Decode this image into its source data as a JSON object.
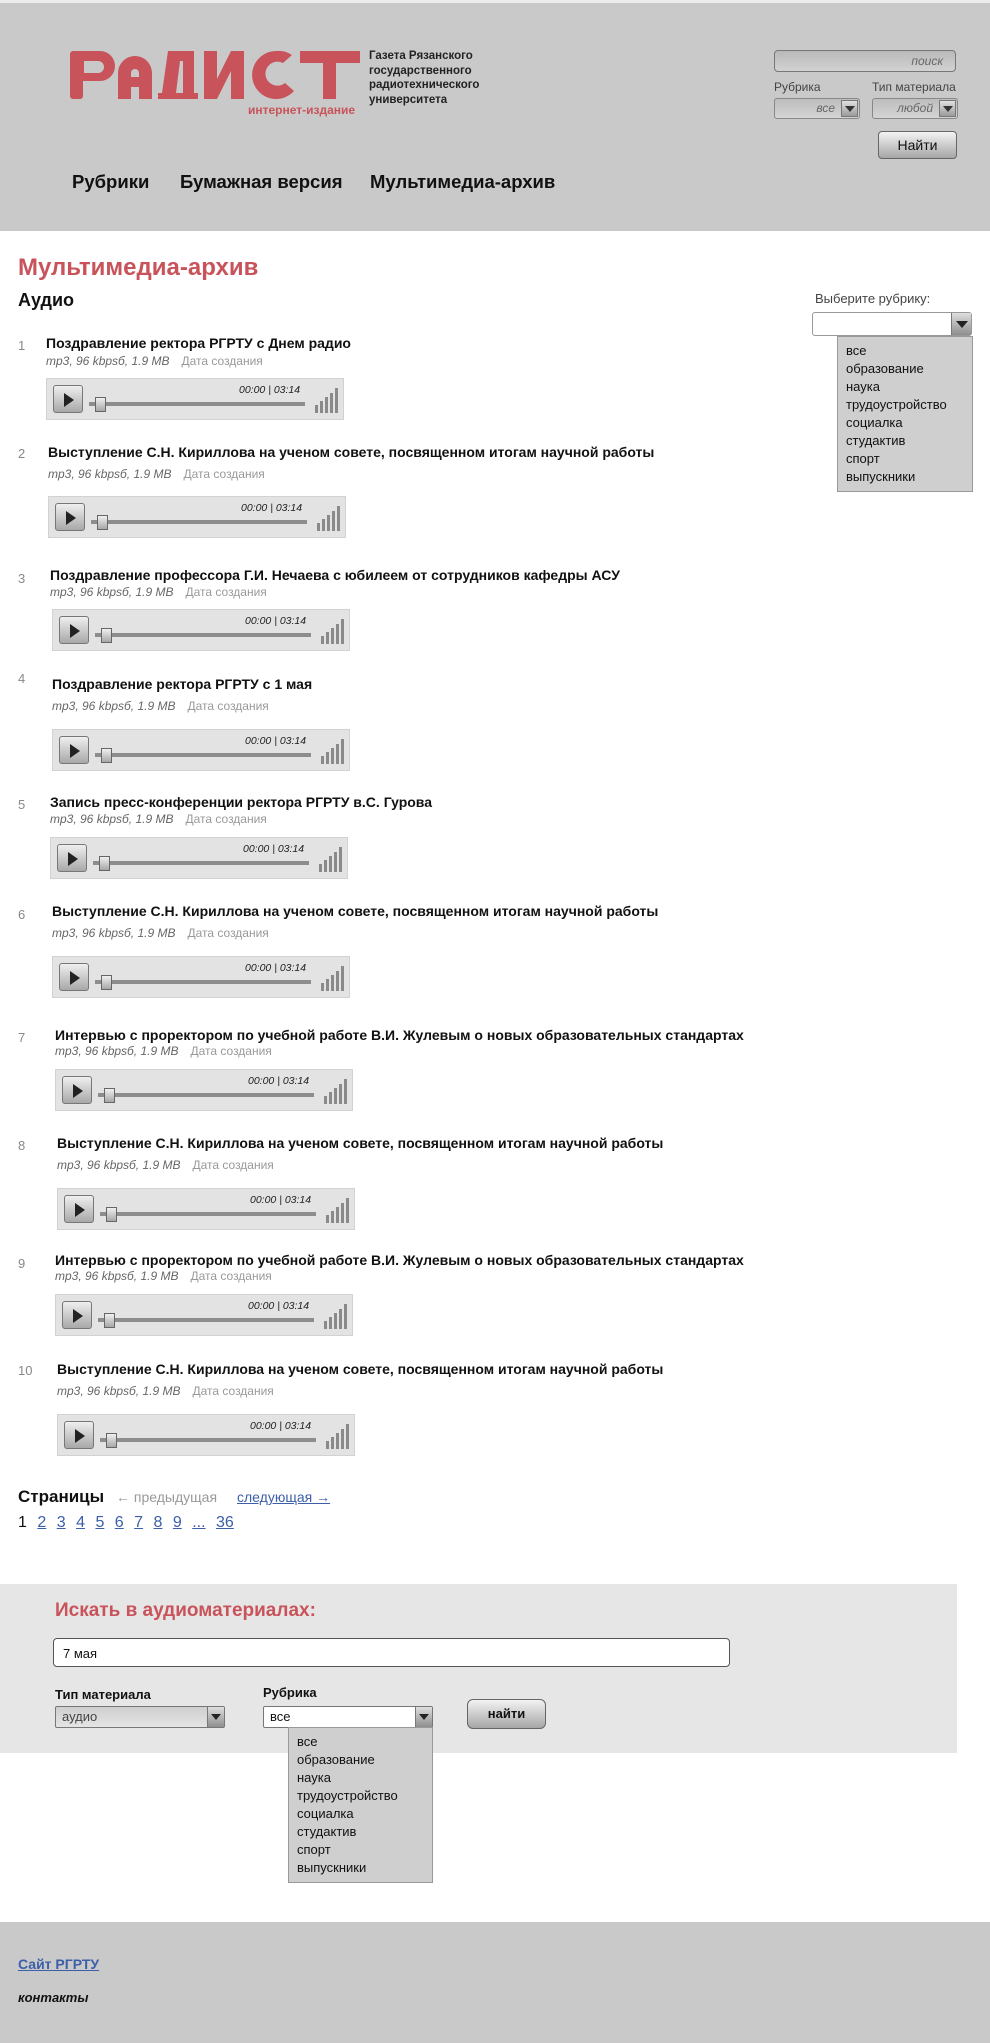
{
  "header": {
    "logo_text": "РАДИСТ",
    "logo_subtitle": "интернет-издание",
    "tagline": "Газета Рязанского государственного радиотехнического университета",
    "search_placeholder": "поиск",
    "rubric_label": "Рубрика",
    "rubric_value": "все",
    "type_label": "Тип материала",
    "type_value": "любой",
    "find_button": "Найти",
    "nav": [
      "Рубрики",
      "Бумажная версия",
      "Мультимедиа-архив"
    ]
  },
  "main": {
    "page_title": "Мультимедиа-архив",
    "section_title": "Аудио",
    "items": [
      {
        "num": "1",
        "title": "Поздравление ректора РГРТУ с Днем радио",
        "format": "mp3, 96 kbpsб, 1.9 MB",
        "date": "Дата создания",
        "time": "00:00  |  03:14"
      },
      {
        "num": "2",
        "title": "Выступление С.Н. Кириллова на ученом совете, посвященном итогам научной работы",
        "format": "mp3, 96 kbpsб, 1.9 MB",
        "date": "Дата создания",
        "time": "00:00  |  03:14"
      },
      {
        "num": "3",
        "title": "Поздравление профессора Г.И. Нечаева с юбилеем от сотрудников кафедры АСУ",
        "format": "mp3, 96 kbpsб, 1.9 MB",
        "date": "Дата создания",
        "time": "00:00  |  03:14"
      },
      {
        "num": "4",
        "title": "Поздравление ректора РГРТУ с 1 мая",
        "format": "mp3, 96 kbpsб, 1.9 MB",
        "date": "Дата создания",
        "time": "00:00  |  03:14"
      },
      {
        "num": "5",
        "title": "Запись пресс-конференции ректора РГРТУ в.С. Гурова",
        "format": "mp3, 96 kbpsб, 1.9 MB",
        "date": "Дата создания",
        "time": "00:00  |  03:14"
      },
      {
        "num": "6",
        "title": "Выступление С.Н. Кириллова на ученом совете, посвященном итогам научной работы",
        "format": "mp3, 96 kbpsб, 1.9 MB",
        "date": "Дата создания",
        "time": "00:00  |  03:14"
      },
      {
        "num": "7",
        "title": "Интервью с проректором по учебной работе В.И. Жулевым о новых образовательных стандартах",
        "format": "mp3, 96 kbpsб, 1.9 MB",
        "date": "Дата создания",
        "time": "00:00  |  03:14"
      },
      {
        "num": "8",
        "title": "Выступление С.Н. Кириллова на ученом совете, посвященном итогам научной работы",
        "format": "mp3, 96 kbpsб, 1.9 MB",
        "date": "Дата создания",
        "time": "00:00  |  03:14"
      },
      {
        "num": "9",
        "title": "Интервью с проректором по учебной работе В.И. Жулевым о новых образовательных стандартах",
        "format": "mp3, 96 kbpsб, 1.9 MB",
        "date": "Дата создания",
        "time": "00:00  |  03:14"
      },
      {
        "num": "10",
        "title": "Выступление С.Н. Кириллова на ученом совете, посвященном итогам научной работы",
        "format": "mp3, 96 kbpsб, 1.9 MB",
        "date": "Дата создания",
        "time": "00:00  |  03:14"
      }
    ]
  },
  "rubric_picker": {
    "label": "Выберите рубрику:",
    "options": [
      "все",
      "образование",
      "наука",
      "трудоустройство",
      "социалка",
      "студактив",
      "спорт",
      "выпускники"
    ]
  },
  "pagination": {
    "title": "Страницы",
    "prev": "← предыдущая",
    "next": "следующая →",
    "current": "1",
    "pages": [
      "2",
      "3",
      "4",
      "5",
      "6",
      "7",
      "8",
      "9",
      "...",
      "36"
    ]
  },
  "search_panel": {
    "title": "Искать в аудиоматериалах:",
    "query": "7 мая",
    "type_label": "Тип материала",
    "type_value": "аудио",
    "rubric_label": "Рубрика",
    "rubric_value": "все",
    "button": "найти",
    "options": [
      "все",
      "образование",
      "наука",
      "трудоустройство",
      "социалка",
      "студактив",
      "спорт",
      "выпускники"
    ]
  },
  "footer": {
    "site_link": "Сайт РГРТУ",
    "contacts": "контакты"
  },
  "colors": {
    "brand_red": "#c9535a",
    "header_gray": "#c9c9c9",
    "link_blue": "#3b5fa8"
  }
}
